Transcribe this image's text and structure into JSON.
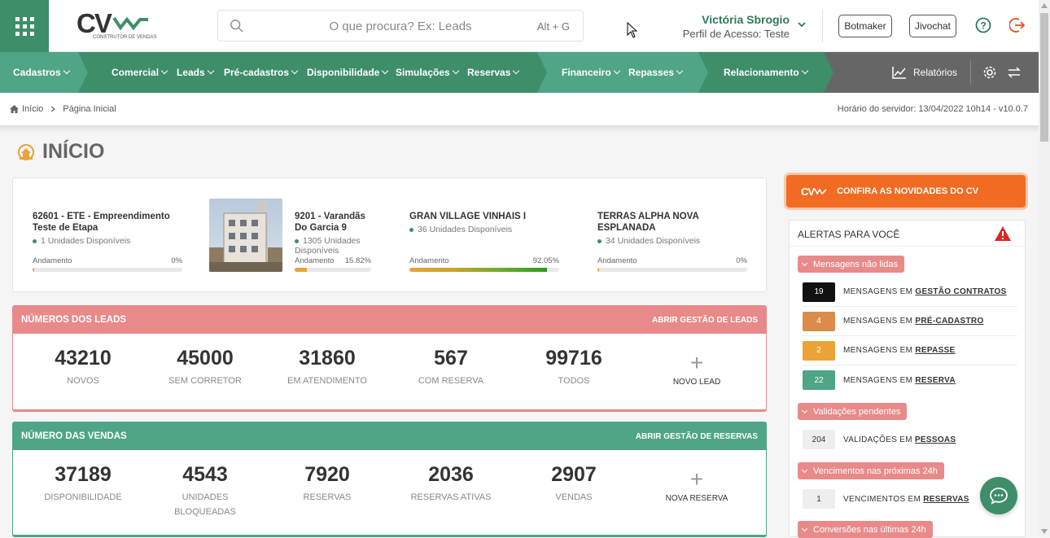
{
  "topbar": {
    "logo_text": "CV",
    "logo_tagline": "CONSTRUTOR DE VENDAS",
    "search_placeholder": "O que procura? Ex: Leads",
    "search_shortcut": "Alt + G",
    "user_name": "Victória Sbrogio",
    "user_profile": "Perfil de Acesso: Teste",
    "botmaker_label": "Botmaker",
    "jivochat_label": "Jivochat"
  },
  "nav": {
    "items": [
      "Cadastros",
      "Comercial",
      "Leads",
      "Pré-cadastros",
      "Disponibilidade",
      "Simulações",
      "Reservas",
      "Financeiro",
      "Repasses",
      "Relacionamento"
    ],
    "reports_label": "Relatórios"
  },
  "breadcrumb": {
    "home": "Início",
    "current": "Página Inicial",
    "server_time": "Horário do servidor: 13/04/2022 10h14 - v10.0.7"
  },
  "page_title": "INÍCIO",
  "empreendimentos": [
    {
      "title": "62601 - ETE - Empreendimento Teste de Etapa",
      "units": "1 Unidades Disponíveis",
      "progress_label": "Andamento",
      "pct": "0%",
      "progress": 0,
      "color": "#e8a33b"
    },
    {
      "title": "9201 - Varandãs Do Garcia 9",
      "units": "1305 Unidades Disponíveis",
      "progress_label": "Andamento",
      "pct": "15.82%",
      "progress": 15.82,
      "color": "#e8a33b"
    },
    {
      "title": "GRAN VILLAGE VINHAIS I",
      "units": "36 Unidades Disponíveis",
      "progress_label": "Andamento",
      "pct": "92.05%",
      "progress": 92.05,
      "color": "#e8a33b"
    },
    {
      "title": "TERRAS ALPHA NOVA ESPLANADA",
      "units": "34 Unidades Disponíveis",
      "progress_label": "Andamento",
      "pct": "0%",
      "progress": 0,
      "color": "#e8a33b"
    }
  ],
  "leads": {
    "header": "NÚMEROS DOS LEADS",
    "link": "ABRIR GESTÃO DE LEADS",
    "stats": [
      {
        "n": "43210",
        "l": "NOVOS"
      },
      {
        "n": "45000",
        "l": "SEM CORRETOR"
      },
      {
        "n": "31860",
        "l": "EM ATENDIMENTO"
      },
      {
        "n": "567",
        "l": "COM RESERVA"
      },
      {
        "n": "99716",
        "l": "TODOS"
      }
    ],
    "new_label": "NOVO LEAD",
    "color": "#e88a8a"
  },
  "vendas": {
    "header": "NÚMERO DAS VENDAS",
    "link": "ABRIR GESTÃO DE RESERVAS",
    "stats": [
      {
        "n": "37189",
        "l": "DISPONIBILIDADE"
      },
      {
        "n": "4543",
        "l": "UNIDADES BLOQUEADAS"
      },
      {
        "n": "7920",
        "l": "RESERVAS"
      },
      {
        "n": "2036",
        "l": "RESERVAS ATIVAS"
      },
      {
        "n": "2907",
        "l": "VENDAS"
      }
    ],
    "new_label": "NOVA RESERVA",
    "color": "#4fa585"
  },
  "novidades": {
    "logo": "CV",
    "label": "CONFIRA AS NOVIDADES DO CV"
  },
  "alerts": {
    "title": "ALERTAS PARA VOCÊ",
    "groups": [
      {
        "label": "Mensagens não lidas",
        "rows": [
          {
            "count": "19",
            "prefix": "MENSAGENS EM ",
            "link": "GESTÃO CONTRATOS",
            "bg": "#111111",
            "fg": "#ffffff"
          },
          {
            "count": "4",
            "prefix": "MENSAGENS EM ",
            "link": "PRÉ-CADASTRO",
            "bg": "#dc8c4a",
            "fg": "#ffffff"
          },
          {
            "count": "2",
            "prefix": "MENSAGENS EM ",
            "link": "REPASSE",
            "bg": "#eba336",
            "fg": "#ffffff"
          },
          {
            "count": "22",
            "prefix": "MENSAGENS EM ",
            "link": "RESERVA",
            "bg": "#4fa585",
            "fg": "#ffffff"
          }
        ]
      },
      {
        "label": "Validações pendentes",
        "rows": [
          {
            "count": "204",
            "prefix": "VALIDAÇÕES EM ",
            "link": "PESSOAS",
            "bg": "#eeeeee",
            "fg": "#333333"
          }
        ]
      },
      {
        "label": "Vencimentos nas próximas 24h",
        "rows": [
          {
            "count": "1",
            "prefix": "VENCIMENTOS EM ",
            "link": "RESERVAS",
            "bg": "#eeeeee",
            "fg": "#333333"
          }
        ]
      },
      {
        "label": "Conversões nas últimas 24h",
        "rows": []
      }
    ]
  }
}
